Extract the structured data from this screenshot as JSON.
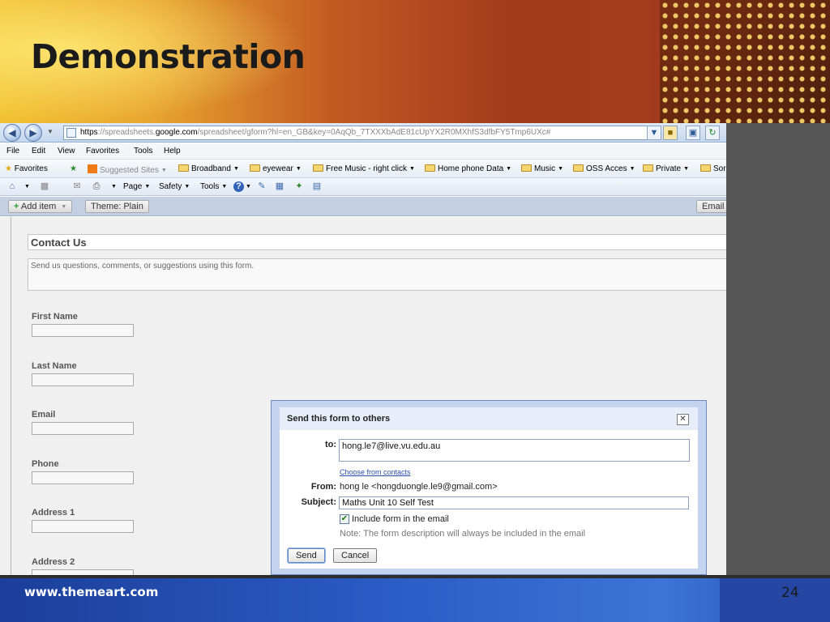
{
  "slide": {
    "title": "Demonstration",
    "footer_site": "www.themeart.com",
    "number": "24"
  },
  "browser": {
    "url_scheme": "https",
    "url_sep": "://",
    "url_sub": "spreadsheets.",
    "url_domain": "google.com",
    "url_path": "/spreadsheet/gform?hl=en_GB&key=0AqQb_7TXXXbAdE81cUpYX2R0MXhfS3dfbFY5Tmp6UXc#",
    "menu": [
      "File",
      "Edit",
      "View",
      "Favorites",
      "Tools",
      "Help"
    ],
    "favorites_label": "Favorites",
    "favorites_bar": [
      "Suggested Sites",
      "Broadband",
      "eyewear",
      "Free Music - right click",
      "Home phone Data",
      "Music",
      "OSS Acces",
      "Private",
      "Sor"
    ],
    "commands": [
      "Page",
      "Safety",
      "Tools"
    ]
  },
  "form_editor": {
    "add_item": "Add item",
    "theme": "Theme: Plain",
    "email": "Email",
    "form_title": "Contact Us",
    "form_description": "Send us questions, comments, or suggestions using this form.",
    "fields": [
      "First Name",
      "Last Name",
      "Email",
      "Phone",
      "Address 1",
      "Address 2"
    ]
  },
  "dialog": {
    "title": "Send this form to others",
    "to_label": "to:",
    "to_value": "hong.le7@live.vu.edu.au",
    "choose_contacts": "Choose from contacts",
    "from_label": "From:",
    "from_value": "hong le <hongduongle.le9@gmail.com>",
    "subject_label": "Subject:",
    "subject_value": "Maths Unit 10 Self Test",
    "include_label": "Include form in the email",
    "include_checked": true,
    "note": "Note: The form description will always be included in the email",
    "send": "Send",
    "cancel": "Cancel"
  },
  "colors": {
    "footer_blue": "#2b5ac4",
    "dialog_border": "#6d8bc0",
    "link_blue": "#2a4fb0"
  },
  "icons": [
    "back-icon",
    "forward-icon",
    "page-icon",
    "lock-icon",
    "refresh-icon",
    "star-icon",
    "folder-icon",
    "home-icon",
    "rss-icon",
    "mail-icon",
    "print-icon",
    "help-icon",
    "close-icon",
    "checkbox-icon"
  ]
}
